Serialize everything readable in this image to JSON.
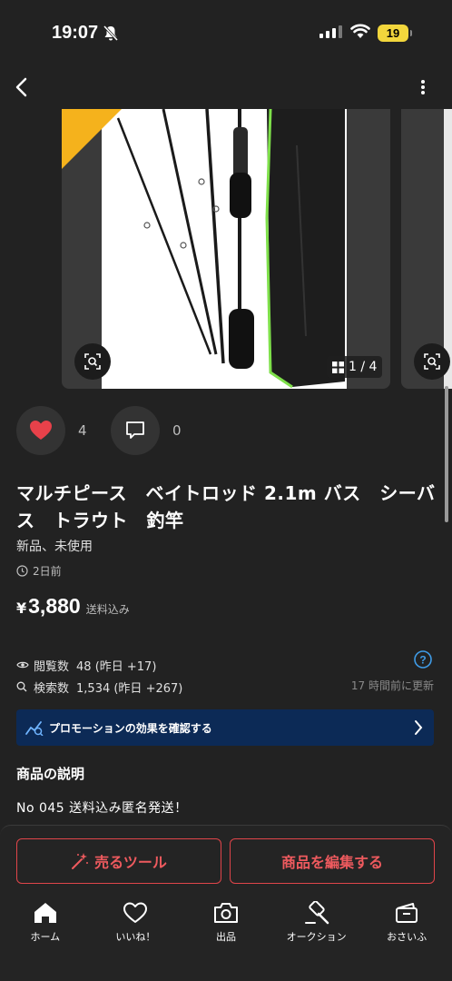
{
  "status_bar": {
    "time": "19:07",
    "battery": "19"
  },
  "gallery": {
    "page_indicator": "1 / 4",
    "current_page": 1,
    "total_pages": 4,
    "badge_color": "#f5b21c"
  },
  "engagement": {
    "likes": "4",
    "comments": "0",
    "like_color": "#e8414a"
  },
  "item": {
    "title": "マルチピース　ベイトロッド 2.1m バス　シーバス　トラウト　釣竿",
    "condition": "新品、未使用",
    "posted": "2日前",
    "currency": "¥",
    "price": "3,880",
    "shipping": "送料込み"
  },
  "stats": {
    "views_label": "閲覧数",
    "views_value": "48 (昨日 +17)",
    "search_label": "検索数",
    "search_value": "1,534 (昨日 +267)",
    "updated": "17 時間前に更新"
  },
  "promo": {
    "label": "プロモーションの効果を確認する",
    "color": "#0c2a56"
  },
  "description": {
    "heading": "商品の説明",
    "text": "No 045  送料込み匿名発送！"
  },
  "actions": {
    "sell_tool": "売るツール",
    "edit": "商品を編集する",
    "accent": "#e0454a"
  },
  "tabs": [
    {
      "label": "ホーム",
      "icon": "home-icon"
    },
    {
      "label": "いいね！",
      "icon": "heart-outline-icon"
    },
    {
      "label": "出品",
      "icon": "camera-icon"
    },
    {
      "label": "オークション",
      "icon": "gavel-icon"
    },
    {
      "label": "おさいふ",
      "icon": "wallet-icon"
    }
  ]
}
